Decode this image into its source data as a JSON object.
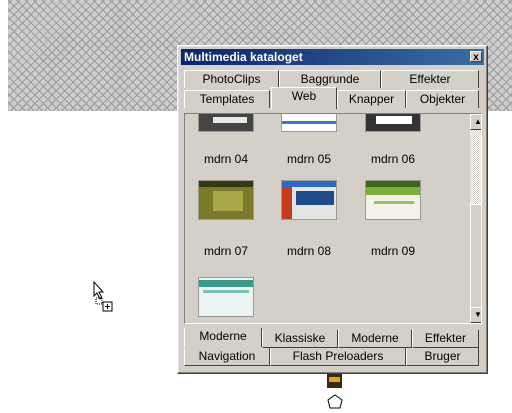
{
  "window": {
    "title": "Multimedia kataloget",
    "close_glyph": "x"
  },
  "top_tabs_row1": [
    {
      "label": "PhotoClips"
    },
    {
      "label": "Baggrunde"
    },
    {
      "label": "Effekter"
    }
  ],
  "top_tabs_row2": [
    {
      "label": "Templates"
    },
    {
      "label": "Web",
      "selected": true
    },
    {
      "label": "Knapper"
    },
    {
      "label": "Objekter"
    }
  ],
  "items": [
    {
      "label": "mdrn 04"
    },
    {
      "label": "mdrn 05"
    },
    {
      "label": "mdrn 06"
    },
    {
      "label": "mdrn 07"
    },
    {
      "label": "mdrn 08"
    },
    {
      "label": "mdrn 09"
    },
    {
      "label": ""
    }
  ],
  "bottom_tabs_row1": [
    {
      "label": "Moderne",
      "selected": true
    },
    {
      "label": "Klassiske"
    },
    {
      "label": "Moderne"
    },
    {
      "label": "Effekter"
    }
  ],
  "bottom_tabs_row2": [
    {
      "label": "Navigation"
    },
    {
      "label": "Flash Preloaders"
    },
    {
      "label": "Bruger"
    }
  ],
  "scrollbar": {
    "up_glyph": "▲",
    "down_glyph": "▼"
  },
  "colors": {
    "titlebar": "#0a246a",
    "face": "#d4d0c8"
  }
}
